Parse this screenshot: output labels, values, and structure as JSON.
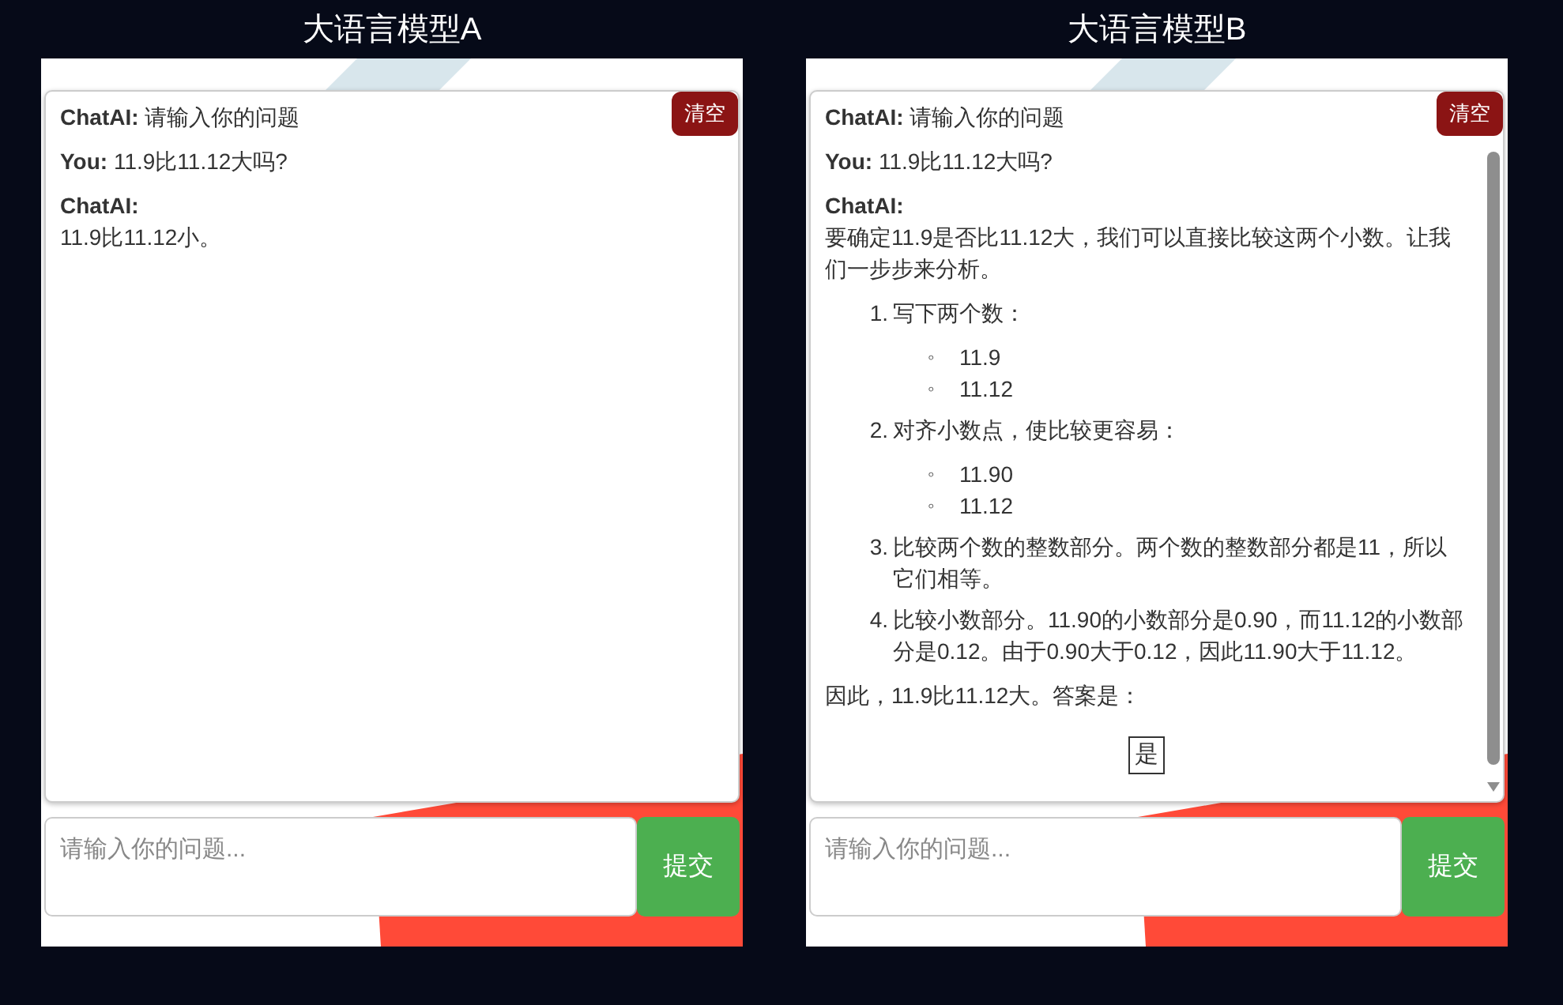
{
  "panels": [
    {
      "title": "大语言模型A",
      "clear_button": "清空",
      "submit_button": "提交",
      "input": {
        "placeholder": "请输入你的问题..."
      },
      "scrollbar": false,
      "messages": [
        {
          "speaker": "ChatAI:",
          "text": "请输入你的问题"
        },
        {
          "speaker": "You:",
          "text": "11.9比11.12大吗?"
        },
        {
          "speaker": "ChatAI:",
          "blocks": [
            {
              "kind": "paragraph",
              "text": "11.9比11.12小。"
            }
          ]
        }
      ]
    },
    {
      "title": "大语言模型B",
      "clear_button": "清空",
      "submit_button": "提交",
      "input": {
        "placeholder": "请输入你的问题..."
      },
      "scrollbar": true,
      "messages": [
        {
          "speaker": "ChatAI:",
          "text": "请输入你的问题"
        },
        {
          "speaker": "You:",
          "text": "11.9比11.12大吗?"
        },
        {
          "speaker": "ChatAI:",
          "blocks": [
            {
              "kind": "paragraph",
              "text": "要确定11.9是否比11.12大，我们可以直接比较这两个小数。让我们一步步来分析。"
            },
            {
              "kind": "ordered_list",
              "items": [
                {
                  "number": "1.",
                  "text": "写下两个数：",
                  "children": [
                    {
                      "marker": "◦",
                      "text": "11.9"
                    },
                    {
                      "marker": "◦",
                      "text": "11.12"
                    }
                  ]
                },
                {
                  "number": "2.",
                  "text": "对齐小数点，使比较更容易：",
                  "children": [
                    {
                      "marker": "◦",
                      "text": "11.90"
                    },
                    {
                      "marker": "◦",
                      "text": "11.12"
                    }
                  ]
                },
                {
                  "number": "3.",
                  "text": "比较两个数的整数部分。两个数的整数部分都是11，所以它们相等。"
                },
                {
                  "number": "4.",
                  "text": "比较小数部分。11.90的小数部分是0.90，而11.12的小数部分是0.12。由于0.90大于0.12，因此11.90大于11.12。"
                }
              ]
            },
            {
              "kind": "paragraph",
              "text": "因此，11.9比11.12大。答案是："
            },
            {
              "kind": "boxed",
              "text": "是"
            }
          ]
        }
      ]
    }
  ]
}
